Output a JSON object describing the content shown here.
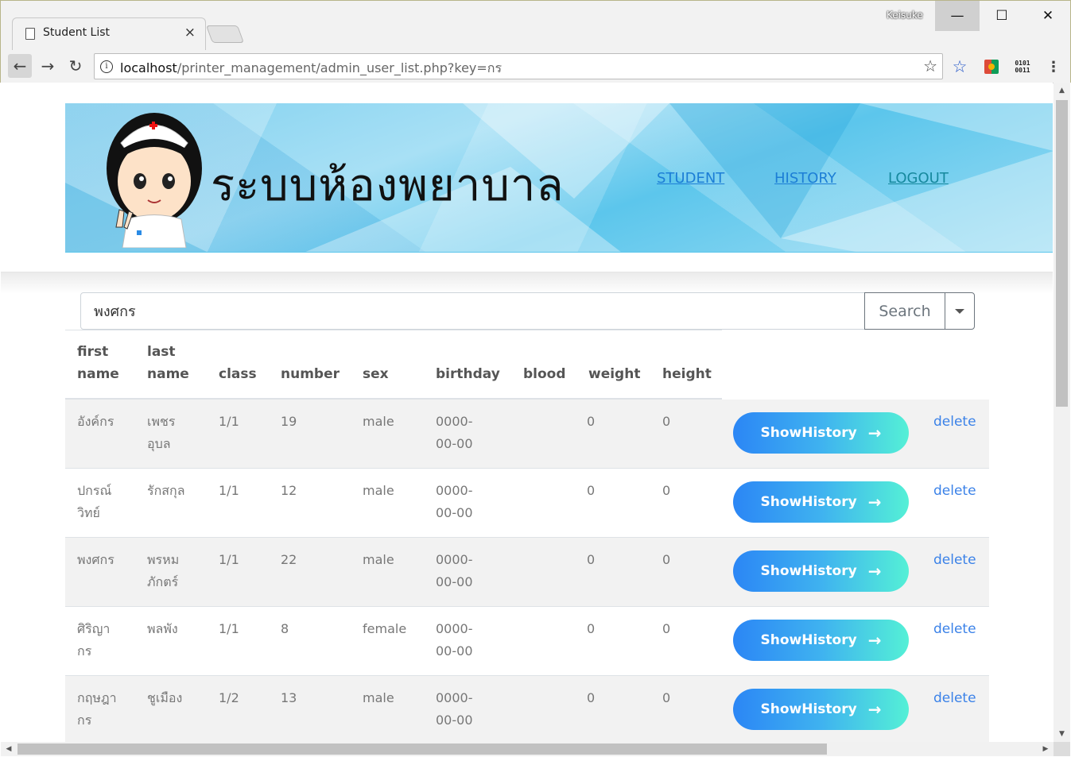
{
  "browser": {
    "tab_title": "Student List",
    "tab_close": "×",
    "profile": "Keisuke",
    "url_host": "localhost",
    "url_path": "/printer_management/admin_user_list.php?key=กร",
    "controls": {
      "minimize": "—",
      "maximize": "☐",
      "close": "✕"
    },
    "nav": {
      "back": "←",
      "forward": "→",
      "reload": "↻"
    }
  },
  "header": {
    "title": "ระบบห้องพยาบาล",
    "nav": {
      "student": "STUDENT",
      "history": "HISTORY",
      "logout": "LOGOUT"
    }
  },
  "search": {
    "value": "พงศกร",
    "button_label": "Search"
  },
  "table": {
    "headers": {
      "first_name": [
        "first",
        "name"
      ],
      "last_name": [
        "last",
        "name"
      ],
      "class": "class",
      "number": "number",
      "sex": "sex",
      "birthday": "birthday",
      "blood": "blood",
      "weight": "weight",
      "height": "height"
    },
    "history_label": "ShowHistory",
    "delete_label": "delete",
    "rows": [
      {
        "first": [
          "อังค์กร"
        ],
        "last": [
          "เพชร",
          "อุบล"
        ],
        "class": "1/1",
        "number": "19",
        "sex": "male",
        "birthday": [
          "0000-",
          "00-00"
        ],
        "blood": "",
        "weight": "0",
        "height": "0"
      },
      {
        "first": [
          "ปกรณ์",
          "วิทย์"
        ],
        "last": [
          "รักสกุล"
        ],
        "class": "1/1",
        "number": "12",
        "sex": "male",
        "birthday": [
          "0000-",
          "00-00"
        ],
        "blood": "",
        "weight": "0",
        "height": "0"
      },
      {
        "first": [
          "พงศกร"
        ],
        "last": [
          "พรหม",
          "ภักตร์"
        ],
        "class": "1/1",
        "number": "22",
        "sex": "male",
        "birthday": [
          "0000-",
          "00-00"
        ],
        "blood": "",
        "weight": "0",
        "height": "0"
      },
      {
        "first": [
          "ศิริญา",
          "กร"
        ],
        "last": [
          "พลพัง"
        ],
        "class": "1/1",
        "number": "8",
        "sex": "female",
        "birthday": [
          "0000-",
          "00-00"
        ],
        "blood": "",
        "weight": "0",
        "height": "0"
      },
      {
        "first": [
          "กฤษฎา",
          "กร"
        ],
        "last": [
          "ชูเมือง"
        ],
        "class": "1/2",
        "number": "13",
        "sex": "male",
        "birthday": [
          "0000-",
          "00-00"
        ],
        "blood": "",
        "weight": "0",
        "height": "0"
      }
    ]
  },
  "colors": {
    "banner_blue": "#5cc6ec",
    "button_gradient_start": "#2b86f5",
    "button_gradient_end": "#54f0d6",
    "link_blue": "#3b82e8"
  }
}
